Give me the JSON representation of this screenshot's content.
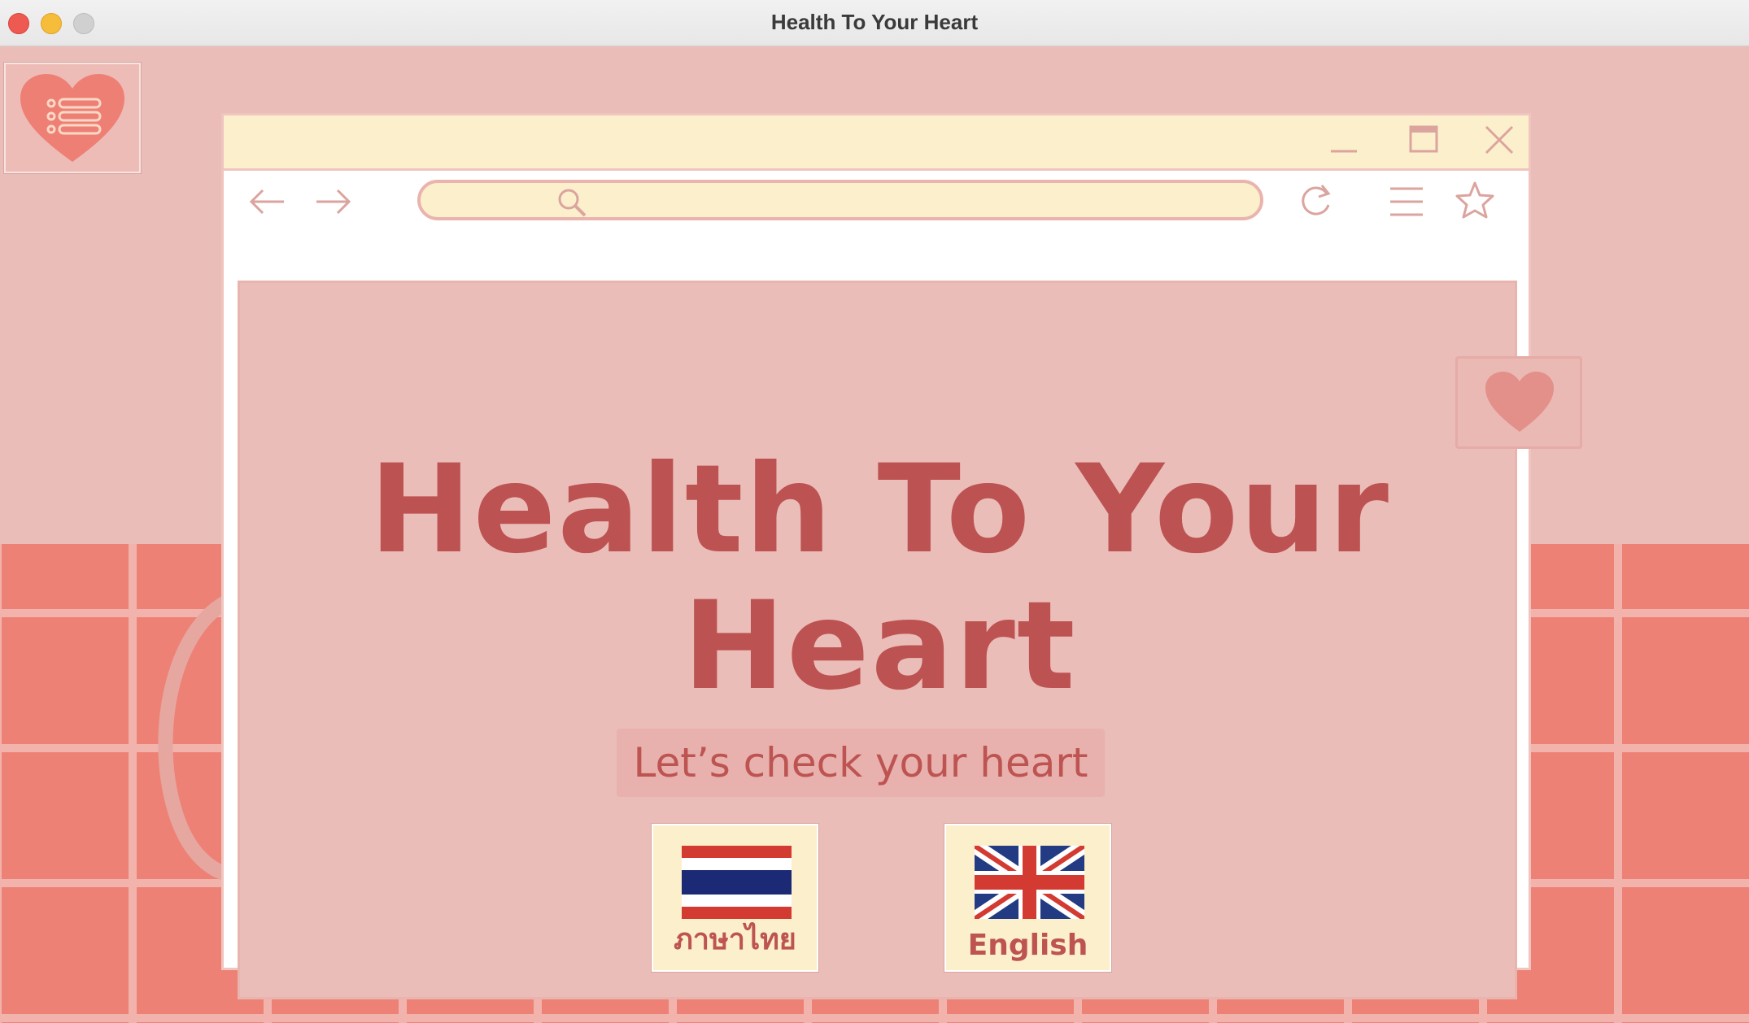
{
  "window": {
    "title": "Health To Your Heart"
  },
  "canvas": {
    "menu_icon": "heart-list-icon"
  },
  "browser_mock": {
    "controls": [
      "minimize-icon",
      "maximize-icon",
      "close-icon"
    ],
    "toolbar_icons": [
      "arrow-left-icon",
      "arrow-right-icon",
      "search-icon",
      "refresh-icon",
      "hamburger-icon",
      "star-icon"
    ],
    "headline_line1": "Health To Your",
    "headline_line2": "Heart",
    "subtitle": "Let’s check your heart",
    "languages": [
      {
        "label": "ภาษาไทย",
        "flag": "thai-flag-icon"
      },
      {
        "label": "English",
        "flag": "uk-flag-icon"
      }
    ]
  },
  "colors": {
    "background": "#ebbdb8",
    "tiles": "#ee8176",
    "headline": "#bc5251",
    "cream": "#fcefcc"
  }
}
